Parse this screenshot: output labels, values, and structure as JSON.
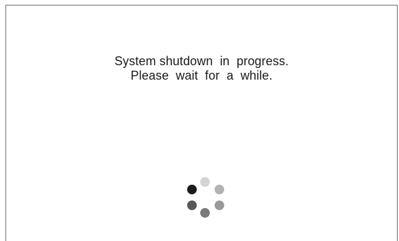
{
  "dialog": {
    "line1": "System shutdown  in  progress.",
    "line2": "Please  wait  for  a  while."
  },
  "spinner": {
    "icon": "loading-spinner-icon",
    "dot_colors": [
      "#d4d4d4",
      "#b3b3b3",
      "#9a9a9a",
      "#7a7a7a",
      "#575757",
      "#1c1c1c"
    ]
  },
  "colors": {
    "background": "#ffffff",
    "border": "#6b6b6b",
    "text": "#1a1a1a"
  }
}
